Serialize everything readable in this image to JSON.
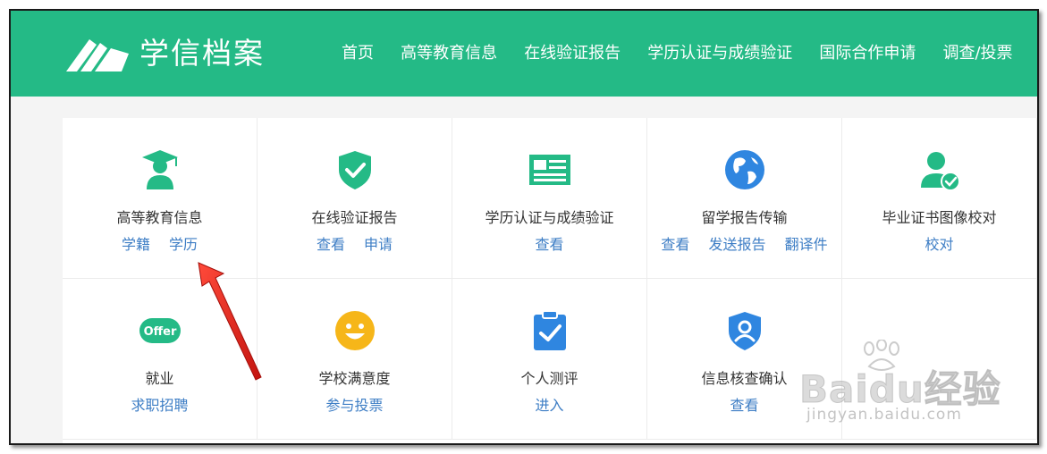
{
  "header": {
    "brand": "学信档案",
    "nav": [
      "首页",
      "高等教育信息",
      "在线验证报告",
      "学历认证与成绩验证",
      "国际合作申请",
      "调查/投票"
    ]
  },
  "services": [
    {
      "title": "高等教育信息",
      "icon": "graduate-icon",
      "links": [
        "学籍",
        "学历"
      ]
    },
    {
      "title": "在线验证报告",
      "icon": "shield-check-icon",
      "links": [
        "查看",
        "申请"
      ]
    },
    {
      "title": "学历认证与成绩验证",
      "icon": "id-card-icon",
      "links": [
        "查看"
      ]
    },
    {
      "title": "留学报告传输",
      "icon": "globe-icon",
      "links": [
        "查看",
        "发送报告",
        "翻译件"
      ]
    },
    {
      "title": "毕业证书图像校对",
      "icon": "user-check-icon",
      "links": [
        "校对"
      ]
    },
    {
      "title": "就业",
      "icon": "offer-icon",
      "icon_text": "Offer",
      "links": [
        "求职招聘"
      ]
    },
    {
      "title": "学校满意度",
      "icon": "smiley-icon",
      "links": [
        "参与投票"
      ]
    },
    {
      "title": "个人测评",
      "icon": "clipboard-check-icon",
      "links": [
        "进入"
      ]
    },
    {
      "title": "信息核查确认",
      "icon": "shield-user-icon",
      "links": [
        "查看"
      ]
    }
  ],
  "watermark": {
    "brand": "Baidu经验",
    "url": "jingyan.baidu.com"
  },
  "colors": {
    "accent": "#24ba86",
    "link": "#3e7ec5",
    "blue": "#2f86e0",
    "yellow": "#f6b619",
    "arrow": "#e8221b"
  }
}
